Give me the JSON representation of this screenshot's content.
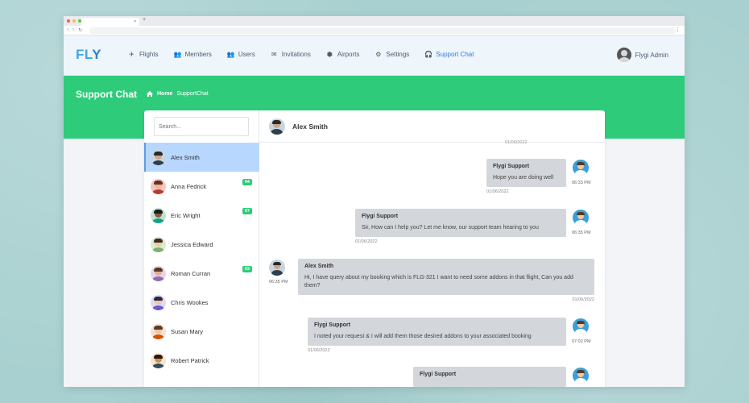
{
  "browser": {
    "tab_close": "×",
    "new_tab": "+",
    "nav": [
      "‹",
      "›",
      "↻"
    ],
    "menu": "⋮"
  },
  "brand": {
    "logo_main": "FL",
    "logo_accent": "Y"
  },
  "nav": {
    "items": [
      {
        "label": "Flights",
        "icon": "airplane-icon",
        "glyph": "✈"
      },
      {
        "label": "Members",
        "icon": "members-icon",
        "glyph": "👥"
      },
      {
        "label": "Users",
        "icon": "users-icon",
        "glyph": "👥"
      },
      {
        "label": "Invitations",
        "icon": "envelope-icon",
        "glyph": "✉"
      },
      {
        "label": "Airports",
        "icon": "cube-icon",
        "glyph": "⬢"
      },
      {
        "label": "Settings",
        "icon": "gear-icon",
        "glyph": "⚙"
      },
      {
        "label": "Support Chat",
        "icon": "headset-icon",
        "glyph": "🎧"
      }
    ],
    "active": "Support Chat",
    "active_color": "#2e7fd9"
  },
  "user": {
    "name": "Flygi Admin"
  },
  "banner": {
    "title": "Support Chat",
    "home": "Home",
    "current": "SupportChat",
    "color": "#2ecc7a"
  },
  "sidebar": {
    "search_placeholder": "Search...",
    "contacts": [
      {
        "name": "Alex Smith",
        "badge": "",
        "active": true
      },
      {
        "name": "Anna Fedrick",
        "badge": "04"
      },
      {
        "name": "Eric Wright",
        "badge": "07"
      },
      {
        "name": "Jessica Edward",
        "badge": ""
      },
      {
        "name": "Roman Curran",
        "badge": "03"
      },
      {
        "name": "Chris Wookes",
        "badge": ""
      },
      {
        "name": "Susan Mary",
        "badge": ""
      },
      {
        "name": "Robert Patrick",
        "badge": ""
      }
    ]
  },
  "chat": {
    "header_name": "Alex Smith",
    "top_date": "01/06/2022",
    "messages": [
      {
        "from": "Flygi Support",
        "text": "Hope you are doing well",
        "date": "01/06/2022",
        "time": "06:33 PM",
        "side": "right"
      },
      {
        "from": "Flygi Support",
        "text": "Sir, How can I help you? Let me know, our support team hearing to you",
        "date": "01/06/2022",
        "time": "06:35 PM",
        "side": "right"
      },
      {
        "from": "Alex Smith",
        "text": "Hi, I have query about my booking which is FLG-321 I want to need some addons in that flight, Can you add them?",
        "date": "01/06/2022",
        "time": "06:35 PM",
        "side": "left"
      },
      {
        "from": "Flygi Support",
        "text": "I noted your request & I will add them those desired addons to your associated booking",
        "date": "01/06/2022",
        "time": "07:02 PM",
        "side": "right"
      },
      {
        "from": "Flygi Support",
        "text": "",
        "date": "",
        "time": "",
        "side": "right"
      }
    ]
  }
}
